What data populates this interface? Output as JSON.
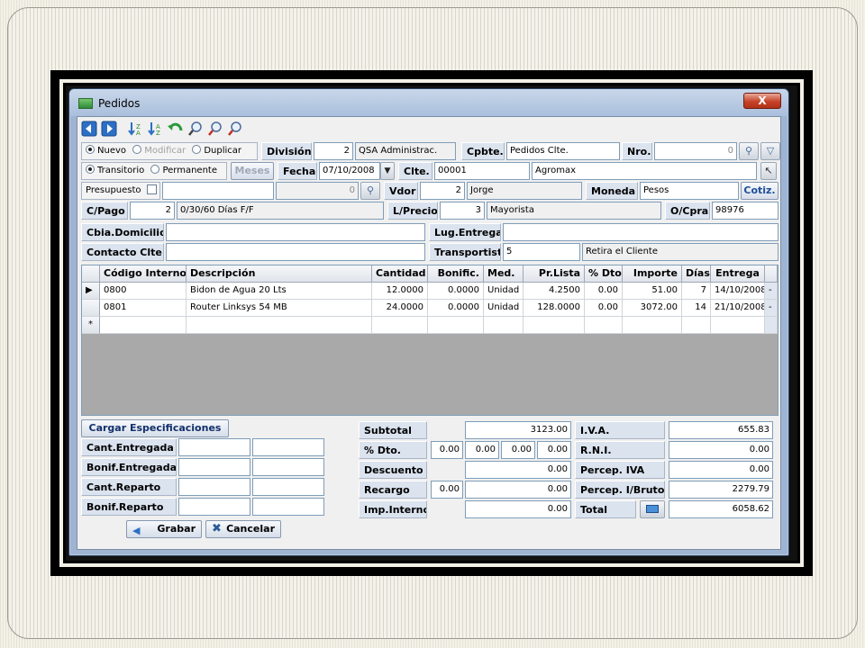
{
  "window": {
    "title": "Pedidos",
    "close_label": "X"
  },
  "toolbar": [
    "arrow-left-icon",
    "arrow-right-icon",
    "sort-asc-icon",
    "sort-desc-icon",
    "undo-icon",
    "search-icon",
    "find-next-icon",
    "find-prev-icon"
  ],
  "row1": {
    "nuevo": "Nuevo",
    "modificar": "Modificar",
    "duplicar": "Duplicar",
    "division_label": "División",
    "division_code": "2",
    "division_name": "QSA Administrac.",
    "cpbte_label": "Cpbte.",
    "cpbte_value": "Pedidos Clte.",
    "nro_label": "Nro.",
    "nro_value": "0"
  },
  "row2": {
    "transitorio": "Transitorio",
    "permanente": "Permanente",
    "meses": "Meses",
    "fecha_label": "Fecha",
    "fecha_value": "07/10/2008",
    "clte_label": "Clte.",
    "clte_code": "00001",
    "clte_name": "Agromax"
  },
  "row3": {
    "presupuesto": "Presupuesto",
    "presupuesto_num": "0",
    "vdor_label": "Vdor",
    "vdor_code": "2",
    "vdor_name": "Jorge",
    "moneda_label": "Moneda",
    "moneda_value": "Pesos",
    "cotiz_label": "Cotiz."
  },
  "row4": {
    "cpago_label": "C/Pago",
    "cpago_code": "2",
    "cpago_desc": "0/30/60 Días F/F",
    "lprecio_label": "L/Precio",
    "lprecio_code": "3",
    "lprecio_name": "Mayorista",
    "ocpra_label": "O/Cpra",
    "ocpra_value": "98976"
  },
  "row5": {
    "cbia_label": "Cbia.Domicilio",
    "lug_label": "Lug.Entrega"
  },
  "row6": {
    "contacto_label": "Contacto Clte.",
    "transportista_label": "Transportista",
    "transportista_code": "5",
    "transportista_name": "Retira el Cliente"
  },
  "grid": {
    "headers": [
      "Código Interno",
      "Descripción",
      "Cantidad",
      "Bonific.",
      "Med.",
      "Pr.Lista",
      "% Dto.",
      "Importe",
      "Días",
      "Entrega"
    ],
    "rows": [
      [
        "0800",
        "Bidon de Agua 20 Lts",
        "12.0000",
        "0.0000",
        "Unidad",
        "4.2500",
        "0.00",
        "51.00",
        "7",
        "14/10/2008"
      ],
      [
        "0801",
        "Router Linksys 54 MB",
        "24.0000",
        "0.0000",
        "Unidad",
        "128.0000",
        "0.00",
        "3072.00",
        "14",
        "21/10/2008"
      ]
    ],
    "new_row_marker": "*"
  },
  "left_panel": {
    "cargar_button": "Cargar Especificaciones",
    "labels": [
      "Cant.Entregada",
      "Bonif.Entregada",
      "Cant.Reparto",
      "Bonif.Reparto"
    ],
    "grabar_button": "Grabar",
    "cancelar_button": "Cancelar"
  },
  "totals": {
    "subtotal_label": "Subtotal",
    "subtotal": "3123.00",
    "dto_label": "% Dto.",
    "dto_values": [
      "0.00",
      "0.00",
      "0.00",
      "0.00"
    ],
    "descuento_label": "Descuento",
    "descuento": "0.00",
    "recargo_label": "Recargo",
    "recargo_pct": "0.00",
    "recargo": "0.00",
    "impint_label": "Imp.Internos",
    "impint": "0.00",
    "iva_label": "I.V.A.",
    "iva": "655.83",
    "rni_label": "R.N.I.",
    "rni": "0.00",
    "percep_iva_label": "Percep. IVA",
    "percep_iva": "0.00",
    "percep_ib_label": "Percep. I/Brutos",
    "percep_ib": "2279.79",
    "total_label": "Total",
    "total": "6058.62"
  },
  "colors": {
    "label_bg": "#dbe3ef",
    "title_bar": "#a9bfdc",
    "close": "#c6432a"
  }
}
